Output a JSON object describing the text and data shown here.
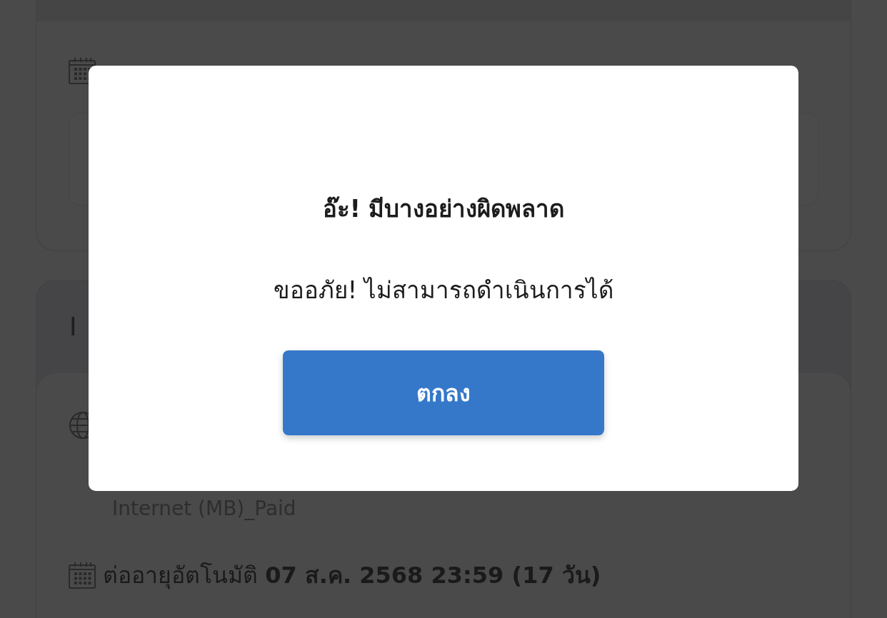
{
  "section": {
    "title": "I",
    "item_name": "Internet (MB)_Paid",
    "renewal": "ต่ออายุอัตโนมัติ **07 ส.ค. 2568 23:59 (17 วัน)**"
  },
  "dialog": {
    "title": "อ๊ะ! มีบางอย่างผิดพลาด",
    "message": "ขออภัย! ไม่สามารถดำเนินการได้",
    "button": "ตกลง"
  }
}
